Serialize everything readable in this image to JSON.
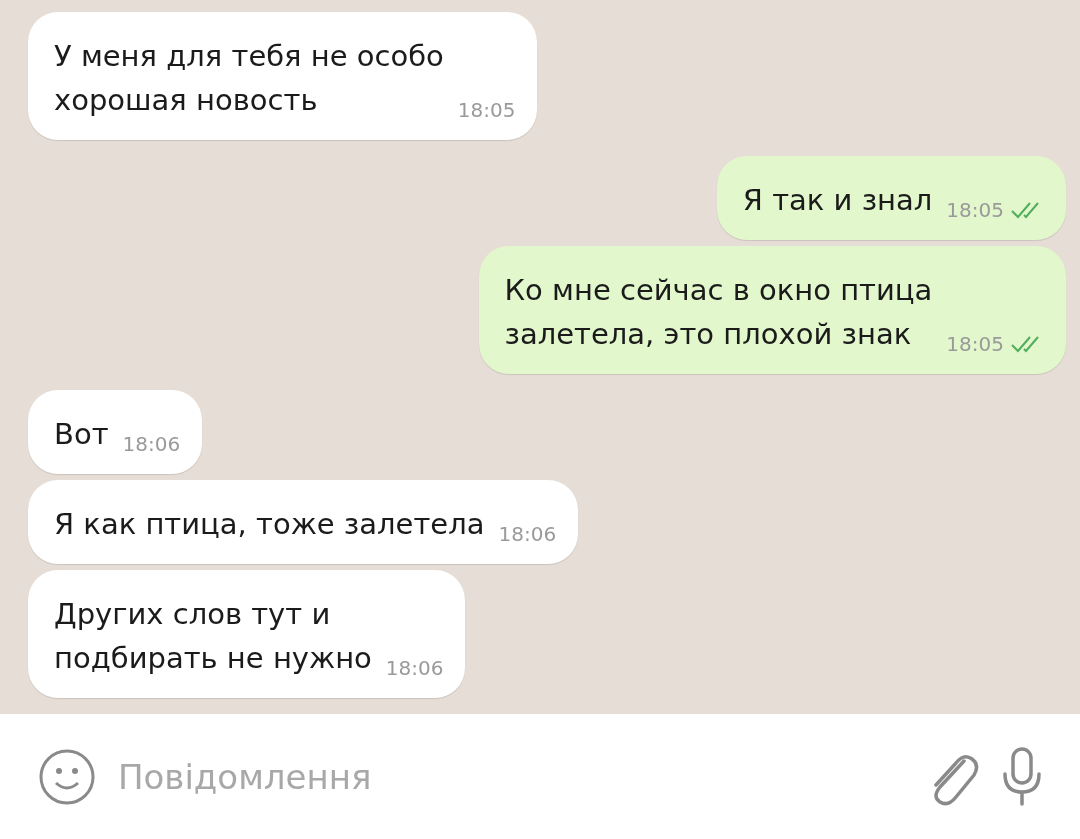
{
  "messages": [
    {
      "kind": "incoming",
      "text": "У меня для тебя не особо\nхорошая новость",
      "time": "18:05"
    },
    {
      "kind": "outgoing",
      "text": "Я так и знал",
      "time": "18:05",
      "read": true
    },
    {
      "kind": "outgoing",
      "text": "Ко мне сейчас в окно птица\nзалетела, это плохой знак",
      "time": "18:05",
      "read": true
    },
    {
      "kind": "incoming",
      "text": "Вот",
      "time": "18:06"
    },
    {
      "kind": "incoming",
      "text": "Я как птица, тоже залетела",
      "time": "18:06"
    },
    {
      "kind": "incoming",
      "text": "Других слов тут и\nподбирать не нужно",
      "time": "18:06"
    }
  ],
  "composer": {
    "placeholder": "Повідомлення"
  }
}
